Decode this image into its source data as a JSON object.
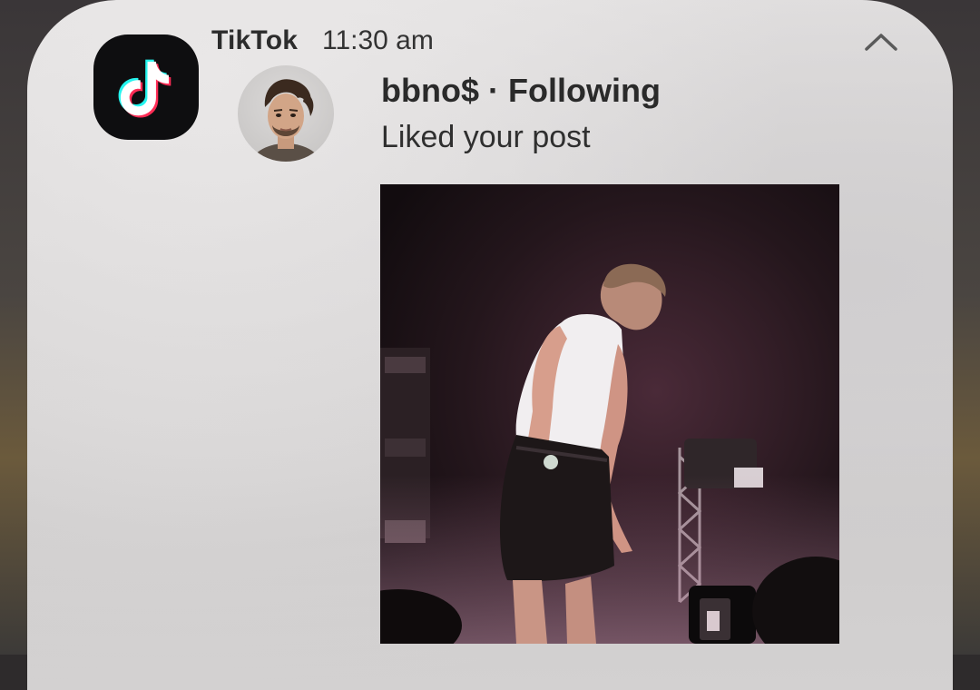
{
  "notification": {
    "app_name": "TikTok",
    "time": "11:30 am",
    "title": "bbno$ · Following",
    "body": "Liked your post",
    "app_icon": "tiktok-logo-icon",
    "collapse_icon": "chevron-up-icon",
    "avatar": "user-avatar",
    "image": "post-thumbnail"
  },
  "colors": {
    "card_bg": "#dcdada",
    "icon_bg": "#0e0e10",
    "tiktok_cyan": "#25f4ee",
    "tiktok_red": "#fe2c55",
    "text_primary": "#2a2a2a"
  }
}
